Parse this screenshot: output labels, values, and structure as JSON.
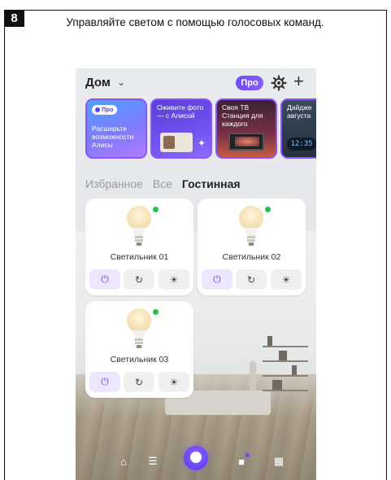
{
  "step": {
    "number": "8"
  },
  "caption": "Управляйте светом с помощью голосовых команд.",
  "app": {
    "home_title": "Дом",
    "pro_label": "Про",
    "stories": [
      {
        "badge": "Про",
        "text": "Расширьте возможности Алисы"
      },
      {
        "text": "Оживите фото — с Алисой"
      },
      {
        "text": "Своя ТВ Станция для каждого"
      },
      {
        "text": "Дайдже августа",
        "clock": "12:35"
      }
    ],
    "tabs": [
      {
        "label": "Избранное",
        "active": false
      },
      {
        "label": "Все",
        "active": false
      },
      {
        "label": "Гостинная",
        "active": true
      }
    ],
    "devices": [
      {
        "name": "Светильник 01",
        "status": "online"
      },
      {
        "name": "Светильник 02",
        "status": "online"
      },
      {
        "name": "Светильник 03",
        "status": "online"
      }
    ],
    "nav": [
      "home-icon",
      "routines-icon",
      "alice-icon",
      "devices-icon",
      "services-icon"
    ],
    "colors": {
      "accent": "#6b47ff",
      "online": "#27c24c"
    }
  }
}
